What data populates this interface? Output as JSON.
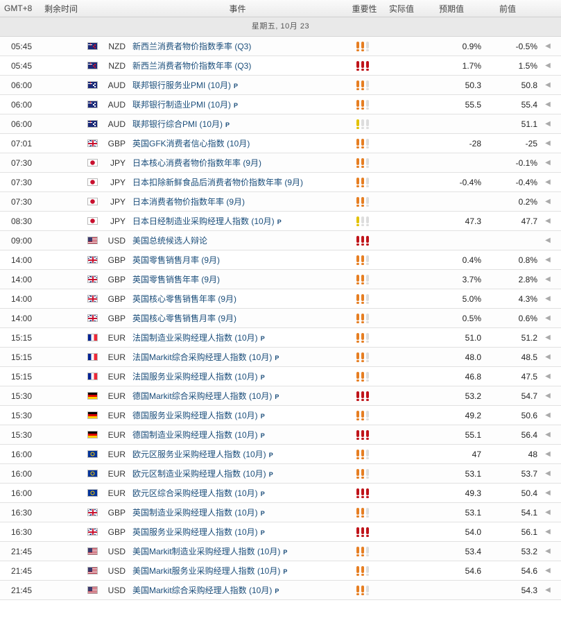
{
  "header": {
    "timezone": "GMT+8",
    "remaining": "剩余时间",
    "event": "事件",
    "importance": "重要性",
    "actual": "实际值",
    "forecast": "预期值",
    "previous": "前值"
  },
  "date_label": "星期五, 10月 23",
  "importance_colors": {
    "low": "#e2c200",
    "medium": "#e67e22",
    "high": "#c0141a",
    "inactive": "#dddddd"
  },
  "arrow_icon": "chevron-left-icon",
  "arrow_glyph": "◀",
  "p_label": "P",
  "events": [
    {
      "time": "05:45",
      "flag": "nz",
      "currency": "NZD",
      "name": "新西兰消费者物价指数季率 (Q3)",
      "p": false,
      "importance": 2,
      "actual": "",
      "forecast": "0.9%",
      "previous": "-0.5%"
    },
    {
      "time": "05:45",
      "flag": "nz",
      "currency": "NZD",
      "name": "新西兰消费者物价指数年率 (Q3)",
      "p": false,
      "importance": 3,
      "actual": "",
      "forecast": "1.7%",
      "previous": "1.5%"
    },
    {
      "time": "06:00",
      "flag": "au",
      "currency": "AUD",
      "name": "联邦银行服务业PMI (10月)",
      "p": true,
      "importance": 2,
      "actual": "",
      "forecast": "50.3",
      "previous": "50.8"
    },
    {
      "time": "06:00",
      "flag": "au",
      "currency": "AUD",
      "name": "联邦银行制造业PMI (10月)",
      "p": true,
      "importance": 2,
      "actual": "",
      "forecast": "55.5",
      "previous": "55.4"
    },
    {
      "time": "06:00",
      "flag": "au",
      "currency": "AUD",
      "name": "联邦银行综合PMI (10月)",
      "p": true,
      "importance": 1,
      "actual": "",
      "forecast": "",
      "previous": "51.1"
    },
    {
      "time": "07:01",
      "flag": "gb",
      "currency": "GBP",
      "name": "英国GFK消费者信心指数 (10月)",
      "p": false,
      "importance": 2,
      "actual": "",
      "forecast": "-28",
      "previous": "-25"
    },
    {
      "time": "07:30",
      "flag": "jp",
      "currency": "JPY",
      "name": "日本核心消费者物价指数年率 (9月)",
      "p": false,
      "importance": 2,
      "actual": "",
      "forecast": "",
      "previous": "-0.1%"
    },
    {
      "time": "07:30",
      "flag": "jp",
      "currency": "JPY",
      "name": "日本扣除新鲜食品后消费者物价指数年率 (9月)",
      "p": false,
      "importance": 2,
      "actual": "",
      "forecast": "-0.4%",
      "previous": "-0.4%"
    },
    {
      "time": "07:30",
      "flag": "jp",
      "currency": "JPY",
      "name": "日本消费者物价指数年率 (9月)",
      "p": false,
      "importance": 2,
      "actual": "",
      "forecast": "",
      "previous": "0.2%"
    },
    {
      "time": "08:30",
      "flag": "jp",
      "currency": "JPY",
      "name": "日本日经制造业采购经理人指数 (10月)",
      "p": true,
      "importance": 1,
      "actual": "",
      "forecast": "47.3",
      "previous": "47.7"
    },
    {
      "time": "09:00",
      "flag": "us",
      "currency": "USD",
      "name": "美国总统候选人辩论",
      "p": false,
      "importance": 3,
      "actual": "",
      "forecast": "",
      "previous": ""
    },
    {
      "time": "14:00",
      "flag": "gb",
      "currency": "GBP",
      "name": "英国零售销售月率 (9月)",
      "p": false,
      "importance": 2,
      "actual": "",
      "forecast": "0.4%",
      "previous": "0.8%"
    },
    {
      "time": "14:00",
      "flag": "gb",
      "currency": "GBP",
      "name": "英国零售销售年率 (9月)",
      "p": false,
      "importance": 2,
      "actual": "",
      "forecast": "3.7%",
      "previous": "2.8%"
    },
    {
      "time": "14:00",
      "flag": "gb",
      "currency": "GBP",
      "name": "英国核心零售销售年率 (9月)",
      "p": false,
      "importance": 2,
      "actual": "",
      "forecast": "5.0%",
      "previous": "4.3%"
    },
    {
      "time": "14:00",
      "flag": "gb",
      "currency": "GBP",
      "name": "英国核心零售销售月率 (9月)",
      "p": false,
      "importance": 2,
      "actual": "",
      "forecast": "0.5%",
      "previous": "0.6%"
    },
    {
      "time": "15:15",
      "flag": "fr",
      "currency": "EUR",
      "name": "法国制造业采购经理人指数 (10月)",
      "p": true,
      "importance": 2,
      "actual": "",
      "forecast": "51.0",
      "previous": "51.2"
    },
    {
      "time": "15:15",
      "flag": "fr",
      "currency": "EUR",
      "name": "法国Markit综合采购经理人指数 (10月)",
      "p": true,
      "importance": 2,
      "actual": "",
      "forecast": "48.0",
      "previous": "48.5"
    },
    {
      "time": "15:15",
      "flag": "fr",
      "currency": "EUR",
      "name": "法国服务业采购经理人指数 (10月)",
      "p": true,
      "importance": 2,
      "actual": "",
      "forecast": "46.8",
      "previous": "47.5"
    },
    {
      "time": "15:30",
      "flag": "de",
      "currency": "EUR",
      "name": "德国Markit综合采购经理人指数 (10月)",
      "p": true,
      "importance": 3,
      "actual": "",
      "forecast": "53.2",
      "previous": "54.7"
    },
    {
      "time": "15:30",
      "flag": "de",
      "currency": "EUR",
      "name": "德国服务业采购经理人指数 (10月)",
      "p": true,
      "importance": 2,
      "actual": "",
      "forecast": "49.2",
      "previous": "50.6"
    },
    {
      "time": "15:30",
      "flag": "de",
      "currency": "EUR",
      "name": "德国制造业采购经理人指数 (10月)",
      "p": true,
      "importance": 3,
      "actual": "",
      "forecast": "55.1",
      "previous": "56.4"
    },
    {
      "time": "16:00",
      "flag": "eu",
      "currency": "EUR",
      "name": "欧元区服务业采购经理人指数 (10月)",
      "p": true,
      "importance": 2,
      "actual": "",
      "forecast": "47",
      "previous": "48"
    },
    {
      "time": "16:00",
      "flag": "eu",
      "currency": "EUR",
      "name": "欧元区制造业采购经理人指数 (10月)",
      "p": true,
      "importance": 2,
      "actual": "",
      "forecast": "53.1",
      "previous": "53.7"
    },
    {
      "time": "16:00",
      "flag": "eu",
      "currency": "EUR",
      "name": "欧元区综合采购经理人指数 (10月)",
      "p": true,
      "importance": 3,
      "actual": "",
      "forecast": "49.3",
      "previous": "50.4"
    },
    {
      "time": "16:30",
      "flag": "gb",
      "currency": "GBP",
      "name": "英国制造业采购经理人指数 (10月)",
      "p": true,
      "importance": 2,
      "actual": "",
      "forecast": "53.1",
      "previous": "54.1"
    },
    {
      "time": "16:30",
      "flag": "gb",
      "currency": "GBP",
      "name": "英国服务业采购经理人指数 (10月)",
      "p": true,
      "importance": 3,
      "actual": "",
      "forecast": "54.0",
      "previous": "56.1"
    },
    {
      "time": "21:45",
      "flag": "us",
      "currency": "USD",
      "name": "美国Markit制造业采购经理人指数 (10月)",
      "p": true,
      "importance": 2,
      "actual": "",
      "forecast": "53.4",
      "previous": "53.2"
    },
    {
      "time": "21:45",
      "flag": "us",
      "currency": "USD",
      "name": "美国Markit服务业采购经理人指数 (10月)",
      "p": true,
      "importance": 2,
      "actual": "",
      "forecast": "54.6",
      "previous": "54.6"
    },
    {
      "time": "21:45",
      "flag": "us",
      "currency": "USD",
      "name": "美国Markit综合采购经理人指数 (10月)",
      "p": true,
      "importance": 2,
      "actual": "",
      "forecast": "",
      "previous": "54.3"
    }
  ]
}
